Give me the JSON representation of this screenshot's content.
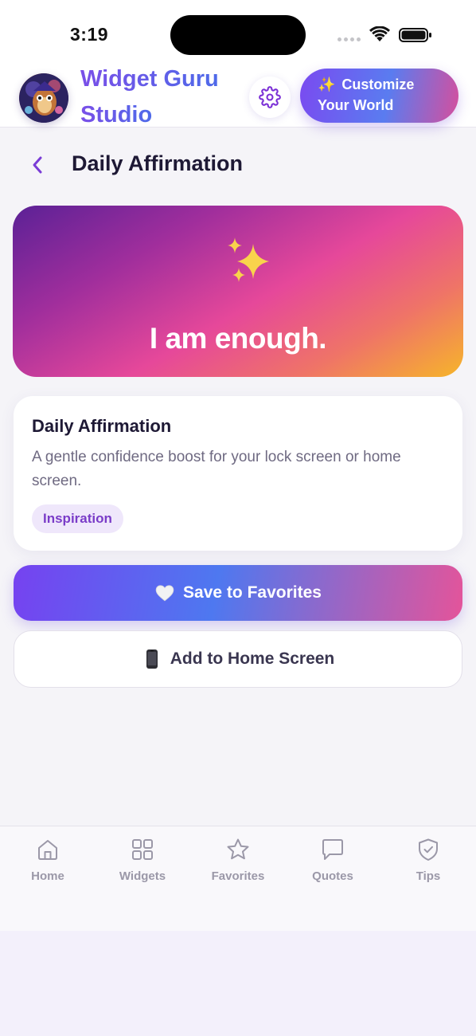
{
  "status_bar": {
    "time": "3:19"
  },
  "header": {
    "brand_line_1": "Widget Guru",
    "brand_line_2": "Studio",
    "customize": {
      "emoji": "✨",
      "line_1": "Customize",
      "line_2": "Your World"
    }
  },
  "page": {
    "title": "Daily Affirmation"
  },
  "hero": {
    "sparkle": "sparkles-icon",
    "text": "I am enough."
  },
  "info_card": {
    "title": "Daily Affirmation",
    "description": "A gentle confidence boost for your lock screen or home screen.",
    "tag": "Inspiration"
  },
  "actions": {
    "favorite_label": "Save to Favorites",
    "favorite_icon": "white-heart-icon",
    "home_label": "Add to Home Screen",
    "home_icon": "phone-icon"
  },
  "tabs": [
    {
      "label": "Home",
      "icon": "home-icon"
    },
    {
      "label": "Widgets",
      "icon": "grid-icon"
    },
    {
      "label": "Favorites",
      "icon": "star-icon"
    },
    {
      "label": "Quotes",
      "icon": "chat-icon"
    },
    {
      "label": "Tips",
      "icon": "shield-check-icon"
    }
  ],
  "colors": {
    "brand_purple": "#7a4fe8",
    "brand_blue": "#4e6ae9",
    "hero_start": "#5b2196",
    "hero_mid": "#e6489a",
    "hero_end": "#f6b52a",
    "tag_text": "#7a3cc8",
    "tab_inactive": "#9b98a8"
  }
}
